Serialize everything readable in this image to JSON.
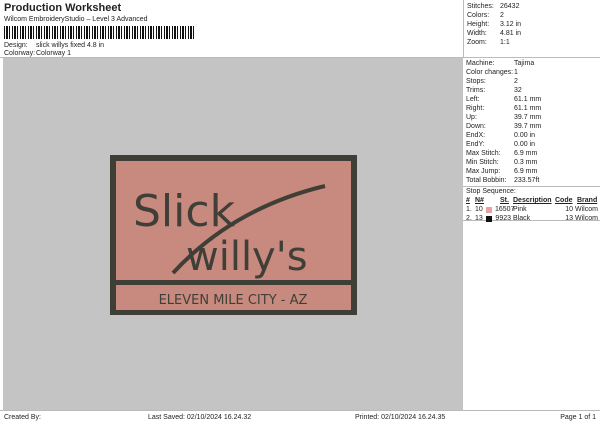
{
  "header": {
    "title": "Production Worksheet",
    "subtitle": "Wilcom EmbroideryStudio – Level 3 Advanced",
    "design_label": "Design:",
    "design_value": "slick willys fixed 4.8 in",
    "colorway_label": "Colorway:",
    "colorway_value": "Colorway 1"
  },
  "summary": [
    {
      "k": "Stitches:",
      "v": "26432"
    },
    {
      "k": "Colors:",
      "v": "2"
    },
    {
      "k": "Height:",
      "v": "3.12 in"
    },
    {
      "k": "Width:",
      "v": "4.81 in"
    },
    {
      "k": "Zoom:",
      "v": "1:1"
    }
  ],
  "details": [
    {
      "k": "Machine:",
      "v": "Tajima"
    },
    {
      "k": "Color changes:",
      "v": "1"
    },
    {
      "k": "Stops:",
      "v": "2"
    },
    {
      "k": "Trims:",
      "v": "32"
    },
    {
      "k": "Left:",
      "v": "61.1 mm"
    },
    {
      "k": "Right:",
      "v": "61.1 mm"
    },
    {
      "k": "Up:",
      "v": "39.7 mm"
    },
    {
      "k": "Down:",
      "v": "39.7 mm"
    },
    {
      "k": "EndX:",
      "v": "0.00 in"
    },
    {
      "k": "EndY:",
      "v": "0.00 in"
    },
    {
      "k": "Max Stitch:",
      "v": "6.9 mm"
    },
    {
      "k": "Min Stitch:",
      "v": "0.3 mm"
    },
    {
      "k": "Max Jump:",
      "v": "6.9 mm"
    },
    {
      "k": "Total Bobbin:",
      "v": "233.57ft"
    }
  ],
  "stop_sequence": {
    "label": "Stop Sequence:",
    "headers": [
      "#",
      "N#",
      "St.",
      "Description",
      "Code",
      "Brand"
    ],
    "rows": [
      {
        "n": "1.",
        "needle": "10",
        "color": "#e8a0a0",
        "st": "16507",
        "desc": "Pink",
        "code": "10",
        "brand": "Wilcom"
      },
      {
        "n": "2.",
        "needle": "13",
        "color": "#111111",
        "st": "9923",
        "desc": "Black",
        "code": "13",
        "brand": "Wilcom"
      }
    ]
  },
  "design": {
    "line1": "Slick",
    "line2": "willy's",
    "line3": "ELEVEN MILE CITY - AZ",
    "fabric_color": "#c8897e",
    "thread_color": "#3f3f38"
  },
  "footer": {
    "created": "Created By:",
    "saved": "Last Saved: 02/10/2024 16.24.32",
    "printed": "Printed: 02/10/2024 16.24.35",
    "page": "Page 1 of 1"
  }
}
